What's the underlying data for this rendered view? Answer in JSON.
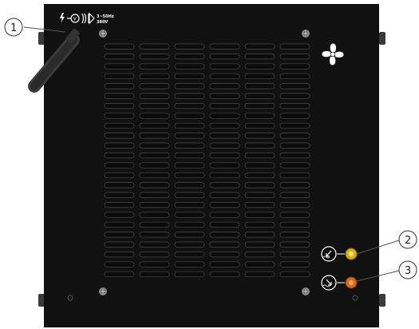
{
  "panel": {
    "body_color": "#111111",
    "slot_color": "#0b0b0b",
    "slot_edge_color": "#4a4a4a",
    "rows": 24,
    "cols": 6
  },
  "label_plate": {
    "symbols": [
      "lightning-bolt-icon",
      "voltage-circle-icon",
      "transformer-rectifier-icon"
    ],
    "spec_line1": "3~50Hz",
    "spec_line2": "380V"
  },
  "fan_symbol": "fan-icon",
  "connectors": [
    {
      "name": "coolant-inlet",
      "color": "#d4b21a",
      "icon": "coolant-inlet-icon"
    },
    {
      "name": "coolant-outlet",
      "color": "#d8661c",
      "icon": "coolant-outlet-icon"
    }
  ],
  "callouts": [
    {
      "label": "1"
    },
    {
      "label": "2"
    },
    {
      "label": "3"
    }
  ]
}
